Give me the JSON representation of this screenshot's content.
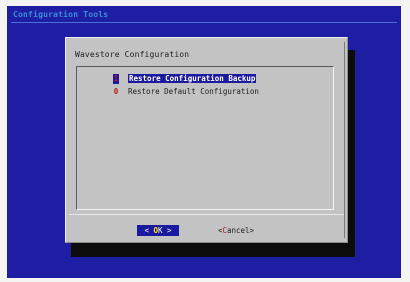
{
  "backtitle": "Configuration Tools",
  "dialog": {
    "title": "Wavestore Configuration"
  },
  "menu": {
    "items": [
      {
        "tag": "1",
        "label": "Restore Configuration Backup",
        "selected": true
      },
      {
        "tag": "0",
        "label": "Restore Default Configuration",
        "selected": false
      }
    ]
  },
  "buttons": {
    "ok": {
      "left": "<",
      "accel": "O",
      "rest": "K",
      "right": ">",
      "selected": true
    },
    "cancel": {
      "left": "<",
      "accel": "C",
      "rest": "ancel",
      "right": ">",
      "selected": false
    }
  },
  "colors": {
    "screen_background": "#1e1ea4",
    "dialog_background": "#c3c3c3",
    "selection": "#1a1aa0",
    "tag_red": "#c01818",
    "backtitle": "#3d8ed6"
  }
}
